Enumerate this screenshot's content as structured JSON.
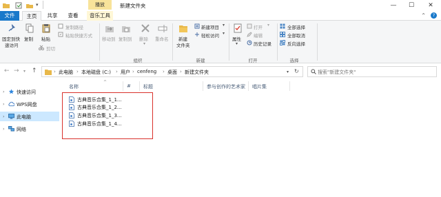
{
  "window": {
    "title": "新建文件夹",
    "context_tab_group": "播放",
    "controls": {
      "minimize": "—",
      "maximize": "☐",
      "close": "✕"
    }
  },
  "tabs": [
    {
      "label": "文件"
    },
    {
      "label": "主页"
    },
    {
      "label": "共享"
    },
    {
      "label": "查看"
    },
    {
      "label": "音乐工具"
    }
  ],
  "ribbon": {
    "clipboard": {
      "pin_label_line1": "固定到快",
      "pin_label_line2": "速访问",
      "copy": "复制",
      "paste": "粘贴",
      "copy_path": "复制路径",
      "paste_shortcut": "粘贴快捷方式",
      "cut": "剪切"
    },
    "organize": {
      "group_label": "组织",
      "move_to": "移动到",
      "copy_to": "复制到",
      "delete": "删除",
      "rename": "重命名"
    },
    "new": {
      "group_label": "新建",
      "new_folder_line1": "新建",
      "new_folder_line2": "文件夹",
      "new_item": "新建项目",
      "easy_access": "轻松访问"
    },
    "open": {
      "group_label": "打开",
      "properties": "属性",
      "open": "打开",
      "edit": "编辑",
      "history": "历史记录"
    },
    "select": {
      "group_label": "选择",
      "select_all": "全部选择",
      "select_none": "全部取消",
      "invert": "反向选择"
    }
  },
  "address": {
    "crumbs": [
      "此电脑",
      "本地磁盘 (C:)",
      "用户",
      "cenfeng",
      "桌面",
      "新建文件夹"
    ],
    "search_placeholder": "搜索\"新建文件夹\""
  },
  "nav": [
    {
      "label": "快速访问"
    },
    {
      "label": "WPS网盘"
    },
    {
      "label": "此电脑"
    },
    {
      "label": "网络"
    }
  ],
  "columns": [
    "名称",
    "#",
    "标题",
    "参与创作的艺术家",
    "唱片集"
  ],
  "files": [
    {
      "name": "古典音乐合集_1_1..."
    },
    {
      "name": "古典音乐合集_1_2..."
    },
    {
      "name": "古典音乐合集_1_3..."
    },
    {
      "name": "古典音乐合集_1_4..."
    }
  ],
  "colors": {
    "accent": "#1979ca",
    "music_tab": "#f8e39a",
    "selection": "#cce8ff",
    "highlight_box": "#d9302a"
  }
}
